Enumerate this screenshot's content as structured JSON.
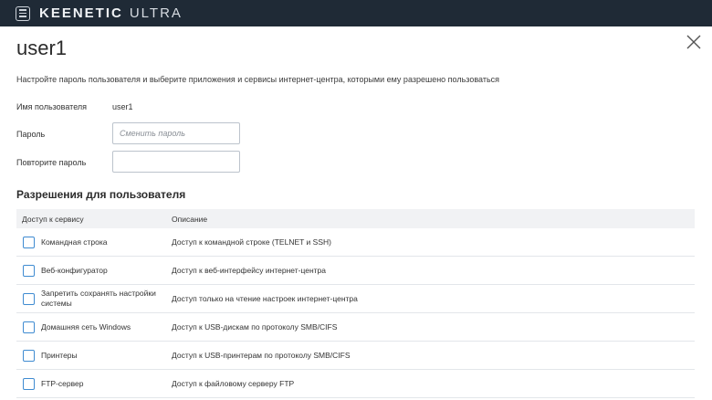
{
  "app": {
    "brand": "KEENETIC",
    "model": "ULTRA"
  },
  "page": {
    "title": "user1",
    "intro": "Настройте пароль пользователя и выберите приложения и сервисы интернет-центра, которыми ему разрешено пользоваться"
  },
  "form": {
    "username_label": "Имя пользователя",
    "username_value": "user1",
    "password_label": "Пароль",
    "password_placeholder": "Сменить пароль",
    "password_value": "",
    "repeat_label": "Повторите пароль",
    "repeat_placeholder": "",
    "repeat_value": ""
  },
  "permissions": {
    "title": "Разрешения для пользователя",
    "headers": [
      "Доступ к сервису",
      "Описание"
    ],
    "rows": [
      {
        "name": "Командная строка",
        "description": "Доступ к командной строке (TELNET и SSH)",
        "checked": false
      },
      {
        "name": "Веб-конфигуратор",
        "description": "Доступ к веб-интерфейсу интернет-центра",
        "checked": false
      },
      {
        "name": "Запретить сохранять настройки системы",
        "description": "Доступ только на чтение настроек интернет-центра",
        "checked": false
      },
      {
        "name": "Домашняя сеть Windows",
        "description": "Доступ к USB-дискам по протоколу SMB/CIFS",
        "checked": false
      },
      {
        "name": "Принтеры",
        "description": "Доступ к USB-принтерам по протоколу SMB/CIFS",
        "checked": false
      },
      {
        "name": "FTP-сервер",
        "description": "Доступ к файловому серверу FTP",
        "checked": false
      }
    ]
  },
  "icons": {
    "menu": "menu-icon",
    "close": "close-icon",
    "checkbox": "checkbox-icon"
  },
  "colors": {
    "topbar": "#1f2a36",
    "checkbox_border": "#3f8bd1",
    "table_header_bg": "#f1f2f4"
  }
}
